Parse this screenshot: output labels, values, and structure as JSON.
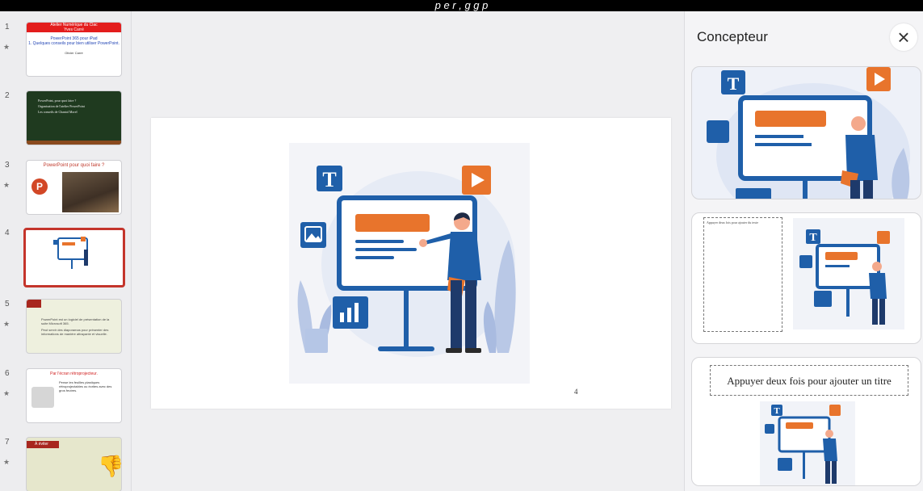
{
  "header_text": "p e r  , g   g p",
  "thumbnails": [
    {
      "number": "1",
      "starred": true,
      "title": "Atelier Numérique du Clac\nYves Carré",
      "subtitle": "PowerPoint 365 pour iPad\n1. Quelques conseils pour bien utiliser PowerPoint.",
      "author": "Olivier Carré"
    },
    {
      "number": "2",
      "starred": false,
      "bullets": [
        "PowerPoint, pour quoi faire ?",
        "Organisation de l'atelier PowerPoint",
        "Les conseils de Chantal Morel"
      ]
    },
    {
      "number": "3",
      "starred": true,
      "title": "PowerPoint pour quoi faire ?"
    },
    {
      "number": "4",
      "starred": false,
      "selected": true
    },
    {
      "number": "5",
      "starred": true,
      "bullets": [
        "PowerPoint est un logiciel de présentation de la suite Microsoft 365.",
        "Peut servir des diaporamas pour présenter des informations de manière attrayante et visuelle."
      ]
    },
    {
      "number": "6",
      "starred": true,
      "title": "Par l'écran rétroprojecteur.",
      "body": "Pense les feuilles plastiques rétroprojectables ou écrites avec des gros feutres."
    },
    {
      "number": "7",
      "starred": true,
      "title": "À éviter"
    }
  ],
  "slide": {
    "page_number": "4"
  },
  "designer": {
    "title": "Concepteur",
    "close_icon": "close-icon",
    "card2_text": "Appuyer deux fois pour ajouter du texte",
    "card3_title": "Appuyer deux fois pour ajouter un titre"
  },
  "colors": {
    "accent_red": "#c4352b",
    "illus_blue": "#1f5fa9",
    "illus_orange": "#e8742c",
    "panel_bg": "#efeff1"
  }
}
